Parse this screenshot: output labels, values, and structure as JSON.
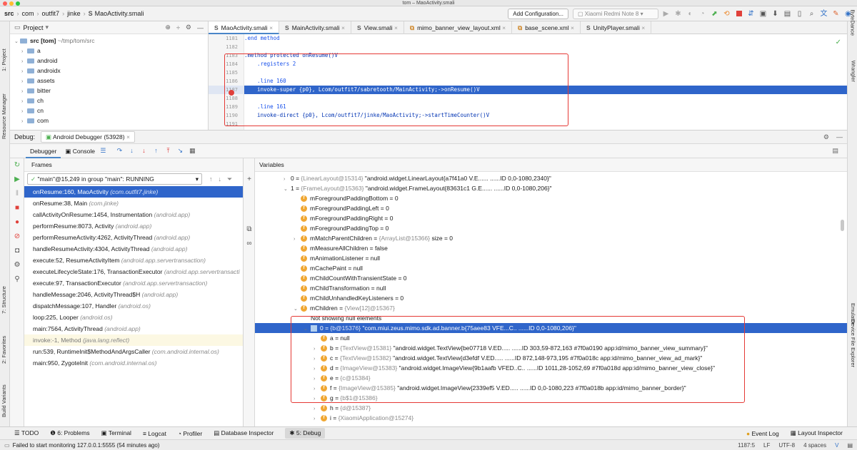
{
  "window": {
    "title": "tom – MaoActivity.smali"
  },
  "breadcrumbs": [
    "src",
    "com",
    "outfit7",
    "jinke",
    "MaoActivity.smali"
  ],
  "toolbar": {
    "add_configuration": "Add Configuration...",
    "device": "Xiaomi Redmi Note 8"
  },
  "project": {
    "header": "Project",
    "root_name": "src [tom]",
    "root_path": "~/tmp/tom/src",
    "folders": [
      "a",
      "android",
      "androidx",
      "assets",
      "bitter",
      "ch",
      "cn",
      "com"
    ]
  },
  "editor": {
    "tabs": [
      "MaoActivity.smali",
      "MainActivity.smali",
      "View.smali",
      "mimo_banner_view_layout.xml",
      "base_scene.xml",
      "UnityPlayer.smali"
    ],
    "line_numbers": [
      "1181",
      "1182",
      "1183",
      "1184",
      "1185",
      "1186",
      "1187",
      "1188",
      "1189",
      "1190",
      "1191"
    ],
    "lines": [
      ".end method",
      "",
      ".method protected onResume()V",
      "    .registers 2",
      "",
      "    .line 160",
      "    invoke-super {p0}, Lcom/outfit7/sabretooth/MainActivity;->onResume()V",
      "",
      "    .line 161",
      "    invoke-direct {p0}, Lcom/outfit7/jinke/MaoActivity;->startTimeCounter()V",
      ""
    ]
  },
  "debug": {
    "label": "Debug:",
    "session_tab": "Android Debugger (53928)",
    "debugger_tab": "Debugger",
    "console_tab": "Console",
    "frames_header": "Frames",
    "variables_header": "Variables",
    "thread": "\"main\"@15,249 in group \"main\": RUNNING",
    "frames": [
      {
        "method": "onResume:160, MaoActivity",
        "pkg": "(com.outfit7.jinke)"
      },
      {
        "method": "onResume:38, Main",
        "pkg": "(com.jinke)"
      },
      {
        "method": "callActivityOnResume:1454, Instrumentation",
        "pkg": "(android.app)"
      },
      {
        "method": "performResume:8073, Activity",
        "pkg": "(android.app)"
      },
      {
        "method": "performResumeActivity:4262, ActivityThread",
        "pkg": "(android.app)"
      },
      {
        "method": "handleResumeActivity:4304, ActivityThread",
        "pkg": "(android.app)"
      },
      {
        "method": "execute:52, ResumeActivityItem",
        "pkg": "(android.app.servertransaction)"
      },
      {
        "method": "executeLifecycleState:176, TransactionExecutor",
        "pkg": "(android.app.servertransacti"
      },
      {
        "method": "execute:97, TransactionExecutor",
        "pkg": "(android.app.servertransaction)"
      },
      {
        "method": "handleMessage:2046, ActivityThread$H",
        "pkg": "(android.app)"
      },
      {
        "method": "dispatchMessage:107, Handler",
        "pkg": "(android.os)"
      },
      {
        "method": "loop:225, Looper",
        "pkg": "(android.os)"
      },
      {
        "method": "main:7564, ActivityThread",
        "pkg": "(android.app)"
      },
      {
        "method": "invoke:-1, Method",
        "pkg": "(java.lang.reflect)"
      },
      {
        "method": "run:539, RuntimeInit$MethodAndArgsCaller",
        "pkg": "(com.android.internal.os)"
      },
      {
        "method": "main:950, ZygoteInit",
        "pkg": "(com.android.internal.os)"
      }
    ],
    "variables": [
      {
        "indent": 0,
        "chev": "›",
        "badge": "",
        "name": "0 = ",
        "type": "{LinearLayout@15314}",
        "value": " \"android.widget.LinearLayout{a7f41a0 V.E...... ......ID 0,0-1080,2340}\""
      },
      {
        "indent": 0,
        "chev": "⌄",
        "badge": "",
        "name": "1 = ",
        "type": "{FrameLayout@15363}",
        "value": " \"android.widget.FrameLayout{83631c1 G.E...... ......ID 0,0-1080,206}\""
      },
      {
        "indent": 1,
        "chev": "",
        "badge": "f",
        "name": "mForegroundPaddingBottom = 0",
        "type": "",
        "value": ""
      },
      {
        "indent": 1,
        "chev": "",
        "badge": "f",
        "name": "mForegroundPaddingLeft = 0",
        "type": "",
        "value": ""
      },
      {
        "indent": 1,
        "chev": "",
        "badge": "f",
        "name": "mForegroundPaddingRight = 0",
        "type": "",
        "value": ""
      },
      {
        "indent": 1,
        "chev": "",
        "badge": "f",
        "name": "mForegroundPaddingTop = 0",
        "type": "",
        "value": ""
      },
      {
        "indent": 1,
        "chev": "›",
        "badge": "f",
        "name": "mMatchParentChildren = ",
        "type": "{ArrayList@15366}",
        "value": "  size = 0"
      },
      {
        "indent": 1,
        "chev": "",
        "badge": "f",
        "name": "mMeasureAllChildren = false",
        "type": "",
        "value": ""
      },
      {
        "indent": 1,
        "chev": "",
        "badge": "f",
        "name": "mAnimationListener = null",
        "type": "",
        "value": ""
      },
      {
        "indent": 1,
        "chev": "",
        "badge": "f",
        "name": "mCachePaint = null",
        "type": "",
        "value": ""
      },
      {
        "indent": 1,
        "chev": "",
        "badge": "f",
        "name": "mChildCountWithTransientState = 0",
        "type": "",
        "value": ""
      },
      {
        "indent": 1,
        "chev": "",
        "badge": "f",
        "name": "mChildTransformation = null",
        "type": "",
        "value": ""
      },
      {
        "indent": 1,
        "chev": "",
        "badge": "f",
        "name": "mChildUnhandledKeyListeners = 0",
        "type": "",
        "value": ""
      },
      {
        "indent": 1,
        "chev": "⌄",
        "badge": "f",
        "name": "mChildren = ",
        "type": "{View[12]@15367}",
        "value": ""
      },
      {
        "indent": 2,
        "chev": "",
        "badge": "",
        "name": "Not showing null elements",
        "type": "",
        "value": ""
      },
      {
        "indent": 2,
        "chev": "⌄",
        "badge": "",
        "name": "0 = ",
        "type": "{b@15376}",
        "value": " \"com.miui.zeus.mimo.sdk.ad.banner.b{75aee83 VFE...C.. ......ID 0,0-1080,206}\"",
        "selected": true
      },
      {
        "indent": 3,
        "chev": "",
        "badge": "f",
        "name": "a = null",
        "type": "",
        "value": ""
      },
      {
        "indent": 3,
        "chev": "›",
        "badge": "f",
        "name": "b = ",
        "type": "{TextView@15381}",
        "value": " \"android.widget.TextView{be07718 V.ED..... ......ID 303,59-872,163 #7f0a0190 app:id/mimo_banner_view_summary}\""
      },
      {
        "indent": 3,
        "chev": "›",
        "badge": "f",
        "name": "c = ",
        "type": "{TextView@15382}",
        "value": " \"android.widget.TextView{d3efdf V.ED..... ......ID 872,148-973,195 #7f0a018c app:id/mimo_banner_view_ad_mark}\""
      },
      {
        "indent": 3,
        "chev": "›",
        "badge": "f",
        "name": "d = ",
        "type": "{ImageView@15383}",
        "value": " \"android.widget.ImageView{9b1aafb VFED..C.. ......ID 1011,28-1052,69 #7f0a018d app:id/mimo_banner_view_close}\""
      },
      {
        "indent": 3,
        "chev": "›",
        "badge": "f",
        "name": "e = ",
        "type": "{c@15384}",
        "value": ""
      },
      {
        "indent": 3,
        "chev": "›",
        "badge": "f",
        "name": "f = ",
        "type": "{ImageView@15385}",
        "value": " \"android.widget.ImageView{2339ef5 V.ED..... ......ID 0,0-1080,223 #7f0a018b app:id/mimo_banner_border}\""
      },
      {
        "indent": 3,
        "chev": "›",
        "badge": "f",
        "name": "g = ",
        "type": "{b$1@15386}",
        "value": ""
      },
      {
        "indent": 3,
        "chev": "›",
        "badge": "f",
        "name": "h = ",
        "type": "{d@15387}",
        "value": ""
      },
      {
        "indent": 3,
        "chev": "›",
        "badge": "f",
        "name": "i = ",
        "type": "{XiaomiApplication@15274}",
        "value": ""
      }
    ]
  },
  "bottom_tools": [
    "TODO",
    "6: Problems",
    "Terminal",
    "Logcat",
    "Profiler",
    "Database Inspector",
    "5: Debug"
  ],
  "bottom_right_tools": [
    "Event Log",
    "Layout Inspector"
  ],
  "left_strip": [
    "1: Project",
    "Resource Manager",
    "7: Structure",
    "2: Favorites",
    "Build Variants"
  ],
  "right_strip": [
    "ByteDance",
    "Wrangler",
    "Emulator",
    "Device File Explorer"
  ],
  "status": {
    "message": "Failed to start monitoring 127.0.0.1:5555 (54 minutes ago)",
    "position": "1187:5",
    "line_sep": "LF",
    "encoding": "UTF-8",
    "indent": "4 spaces"
  },
  "colors": {
    "accent": "#2f65ca",
    "highlight_box": "#e53935"
  }
}
